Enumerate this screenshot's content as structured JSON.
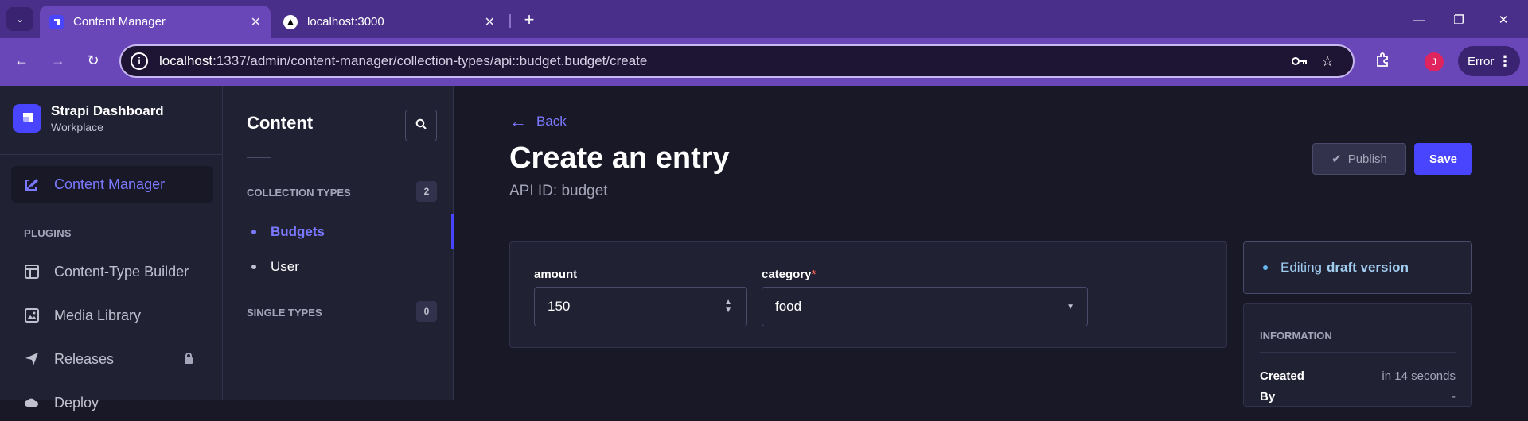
{
  "browser": {
    "tabs": [
      {
        "title": "Content Manager",
        "active": true,
        "close": "✕"
      },
      {
        "title": "localhost:3000",
        "active": false,
        "close": "✕"
      }
    ],
    "url_host": "localhost",
    "url_rest": ":1337/admin/content-manager/collection-types/api::budget.budget/create",
    "profile_initial": "J",
    "error_label": "Error"
  },
  "mainnav": {
    "brand_title": "Strapi Dashboard",
    "brand_subtitle": "Workplace",
    "active_item": "Content Manager",
    "plugins_label": "PLUGINS",
    "items": [
      {
        "label": "Content-Type Builder",
        "icon": "layout-icon"
      },
      {
        "label": "Media Library",
        "icon": "image-icon"
      },
      {
        "label": "Releases",
        "icon": "paper-plane-icon",
        "locked": true
      },
      {
        "label": "Deploy",
        "icon": "cloud-icon"
      }
    ]
  },
  "subnav": {
    "title": "Content",
    "collection_types_label": "COLLECTION TYPES",
    "collection_types_count": "2",
    "collection_items": [
      "Budgets",
      "User"
    ],
    "single_types_label": "SINGLE TYPES",
    "single_types_count": "0"
  },
  "main": {
    "back_label": "Back",
    "title": "Create an entry",
    "api_id": "API ID: budget",
    "publish_label": "Publish",
    "save_label": "Save",
    "fields": {
      "amount_label": "amount",
      "amount_value": "150",
      "category_label": "category",
      "category_required": "*",
      "category_value": "food"
    },
    "status": {
      "prefix": "Editing",
      "emphasis": "draft version"
    },
    "information": {
      "heading": "INFORMATION",
      "created_label": "Created",
      "created_value": "in 14 seconds",
      "by_label": "By",
      "by_value": "-"
    }
  },
  "colors": {
    "accent": "#4945ff",
    "accent_text": "#7b79ff",
    "browser_frame": "#6a47b8",
    "app_bg": "#181826",
    "panel_bg": "#212134"
  }
}
